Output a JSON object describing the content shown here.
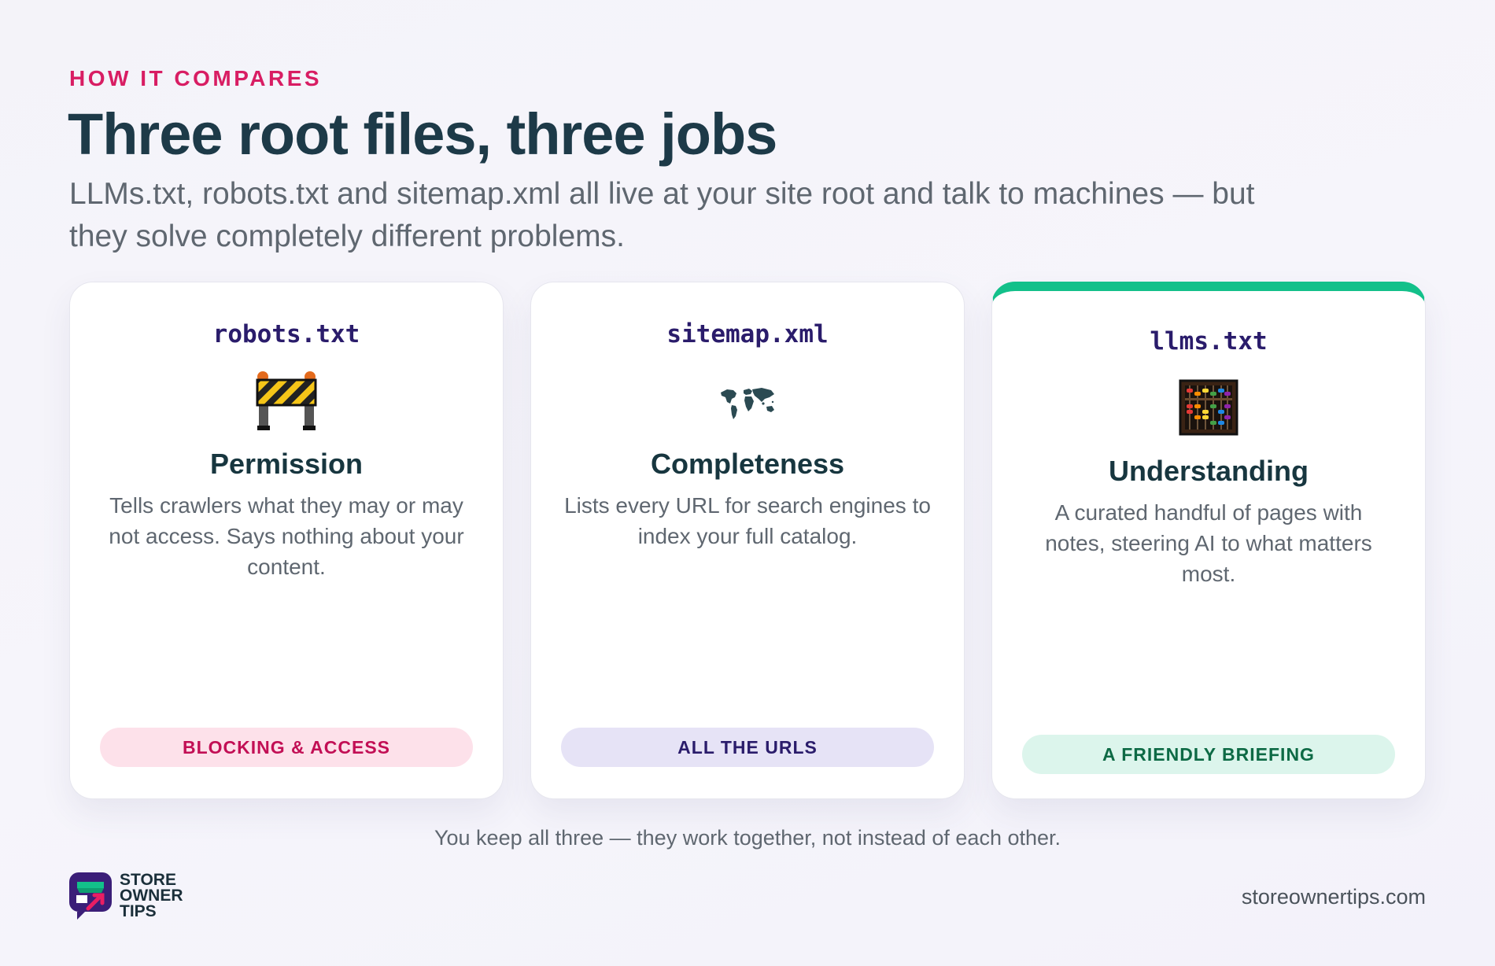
{
  "header": {
    "eyebrow": "HOW IT COMPARES",
    "title": "Three root files, three jobs",
    "subtitle": "LLMs.txt, robots.txt and sitemap.xml all live at your site root and talk to machines — but they solve completely different problems."
  },
  "cards": [
    {
      "filename": "robots.txt",
      "icon": "construction-barrier-icon",
      "title": "Permission",
      "description": "Tells crawlers what they may or may not access. Says nothing about your content.",
      "pill": "BLOCKING & ACCESS",
      "pill_color": "#c20f55"
    },
    {
      "filename": "sitemap.xml",
      "icon": "world-map-icon",
      "title": "Completeness",
      "description": "Lists every URL for search engines to index your full catalog.",
      "pill": "ALL THE URLS",
      "pill_color": "#2a1c6b"
    },
    {
      "filename": "llms.txt",
      "icon": "abacus-icon",
      "title": "Understanding",
      "description": "A curated handful of pages with notes, steering AI to what matters most.",
      "pill": "A FRIENDLY BRIEFING",
      "pill_color": "#0d6a45",
      "accent_color": "#13c08a"
    }
  ],
  "footer": {
    "note": "You keep all three — they work together, not instead of each other.",
    "logo_lines": [
      "STORE",
      "OWNER",
      "TIPS"
    ],
    "site_url": "storeownertips.com"
  }
}
